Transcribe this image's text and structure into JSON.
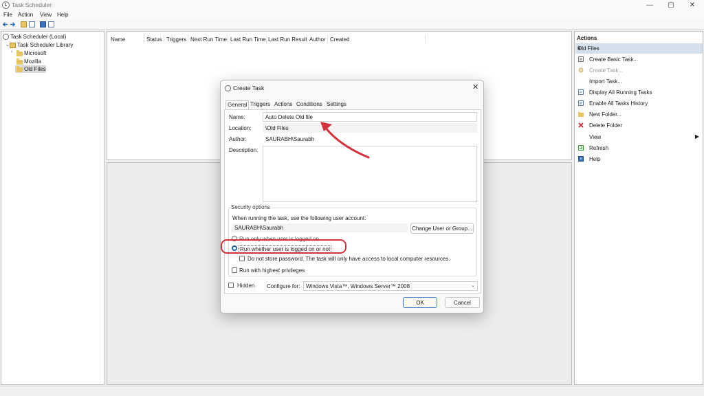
{
  "window": {
    "title": "Task Scheduler",
    "controls": {
      "minimize": "—",
      "maximize": "▢",
      "close": "✕"
    }
  },
  "menu": [
    "File",
    "Action",
    "View",
    "Help"
  ],
  "toolbar": {
    "icons": [
      "back-arrow-icon",
      "forward-arrow-icon",
      "folder-up-icon",
      "show-hide-tree-icon",
      "help-icon",
      "show-hide-action-pane-icon"
    ]
  },
  "tree": {
    "root": "Task Scheduler (Local)",
    "library": "Task Scheduler Library",
    "items": [
      "Microsoft",
      "Mozilla",
      "Old Files"
    ],
    "selected": "Old Files"
  },
  "task_list": {
    "columns": [
      "Name",
      "Status",
      "Triggers",
      "Next Run Time",
      "Last Run Time",
      "Last Run Result",
      "Author",
      "Created"
    ]
  },
  "actions": {
    "title": "Actions",
    "section": "Old Files",
    "items": [
      {
        "label": "Create Basic Task...",
        "icon": "create-basic-task-icon",
        "disabled": false
      },
      {
        "label": "Create Task...",
        "icon": "create-task-icon",
        "disabled": true
      },
      {
        "label": "Import Task...",
        "icon": "",
        "disabled": false
      },
      {
        "label": "Display All Running Tasks",
        "icon": "running-tasks-icon",
        "disabled": false
      },
      {
        "label": "Enable All Tasks History",
        "icon": "history-icon",
        "disabled": false
      },
      {
        "label": "New Folder...",
        "icon": "new-folder-icon",
        "disabled": false
      },
      {
        "label": "Delete Folder",
        "icon": "delete-icon",
        "disabled": false
      },
      {
        "label": "View",
        "icon": "",
        "disabled": false,
        "submenu": true
      },
      {
        "label": "Refresh",
        "icon": "refresh-icon",
        "disabled": false
      },
      {
        "label": "Help",
        "icon": "help-icon",
        "disabled": false
      }
    ]
  },
  "dialog": {
    "title": "Create Task",
    "tabs": [
      "General",
      "Triggers",
      "Actions",
      "Conditions",
      "Settings"
    ],
    "active_tab": "General",
    "name_label": "Name:",
    "name_value": "Auto Delete Old file",
    "location_label": "Location:",
    "location_value": "\\Old Files",
    "author_label": "Author:",
    "author_value": "SAURABH\\Saurabh",
    "description_label": "Description:",
    "description_value": "",
    "security": {
      "legend": "Security options",
      "account_prompt": "When running the task, use the following user account:",
      "account": "SAURABH\\Saurabh",
      "change_button": "Change User or Group...",
      "opt_logged_on": "Run only when user is logged on",
      "opt_whether": "Run whether user is logged on or not",
      "selected_option": "Run whether user is logged on or not",
      "no_store_password": "Do not store password.  The task will only have access to local computer resources.",
      "no_store_password_checked": false,
      "highest_privileges": "Run with highest privileges",
      "highest_privileges_checked": false
    },
    "hidden_label": "Hidden",
    "hidden_checked": false,
    "configure_label": "Configure for:",
    "configure_value": "Windows Vista™, Windows Server™ 2008",
    "ok": "OK",
    "cancel": "Cancel"
  },
  "annotations": {
    "color": "#d6303a"
  },
  "colors": {
    "selection": "#d3dfeb",
    "primary_border": "#3f7fd1"
  }
}
